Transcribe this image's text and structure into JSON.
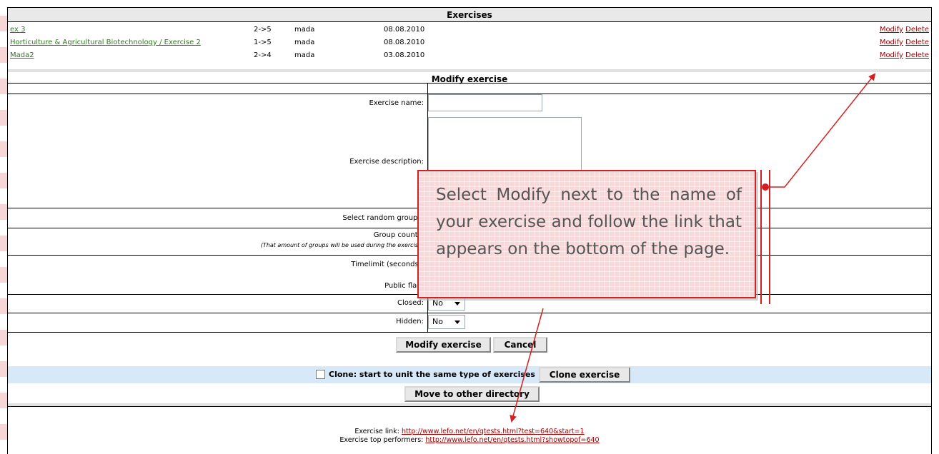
{
  "exercises": {
    "title": "Exercises",
    "rows": [
      {
        "name": "ex 3",
        "range": "2->5",
        "user": "mada",
        "date": "08.08.2010",
        "modify": "Modify",
        "delete": "Delete"
      },
      {
        "name": "Horticulture & Agricultural Biotechnology / Exercise 2",
        "range": "1->5",
        "user": "mada",
        "date": "08.08.2010",
        "modify": "Modify",
        "delete": "Delete"
      },
      {
        "name": "Mada2",
        "range": "2->4",
        "user": "mada",
        "date": "03.08.2010",
        "modify": "Modify",
        "delete": "Delete"
      }
    ]
  },
  "modify_form": {
    "title": "Modify exercise",
    "name_label": "Exercise name:",
    "name_value": "",
    "description_label": "Exercise description:",
    "random_groups_label": "Select random groups:",
    "group_count_label": "Group count*:",
    "group_count_note": "(That amount of groups will be used during the exercise)",
    "timelimit_label": "Timelimit (seconds):",
    "public_flag_label": "Public flag:",
    "closed_label": "Closed:",
    "closed_value": "No",
    "hidden_label": "Hidden:",
    "hidden_value": "No",
    "modify_button": "Modify exercise",
    "cancel_button": "Cancel"
  },
  "clone": {
    "label": "Clone: start to unit the same type of exercises",
    "button": "Clone exercise",
    "move_button": "Move to other directory"
  },
  "links": {
    "exercise_link_label": "Exercise link:",
    "exercise_link_url": "http://www.lefo.net/en/qtests.html?test=640&start=1",
    "top_performers_label": "Exercise top performers:",
    "top_performers_url": "http://www.lefo.net/en/qtests.html?showtopof=640"
  },
  "callout": {
    "text": "Select Modify next to the name of your exercise and follow the link that appears on the bottom of the page."
  },
  "colors": {
    "accent_red": "#d42020",
    "link_green": "#2a7a1a",
    "link_red": "#a00000",
    "clone_band": "#d7e8f8"
  }
}
